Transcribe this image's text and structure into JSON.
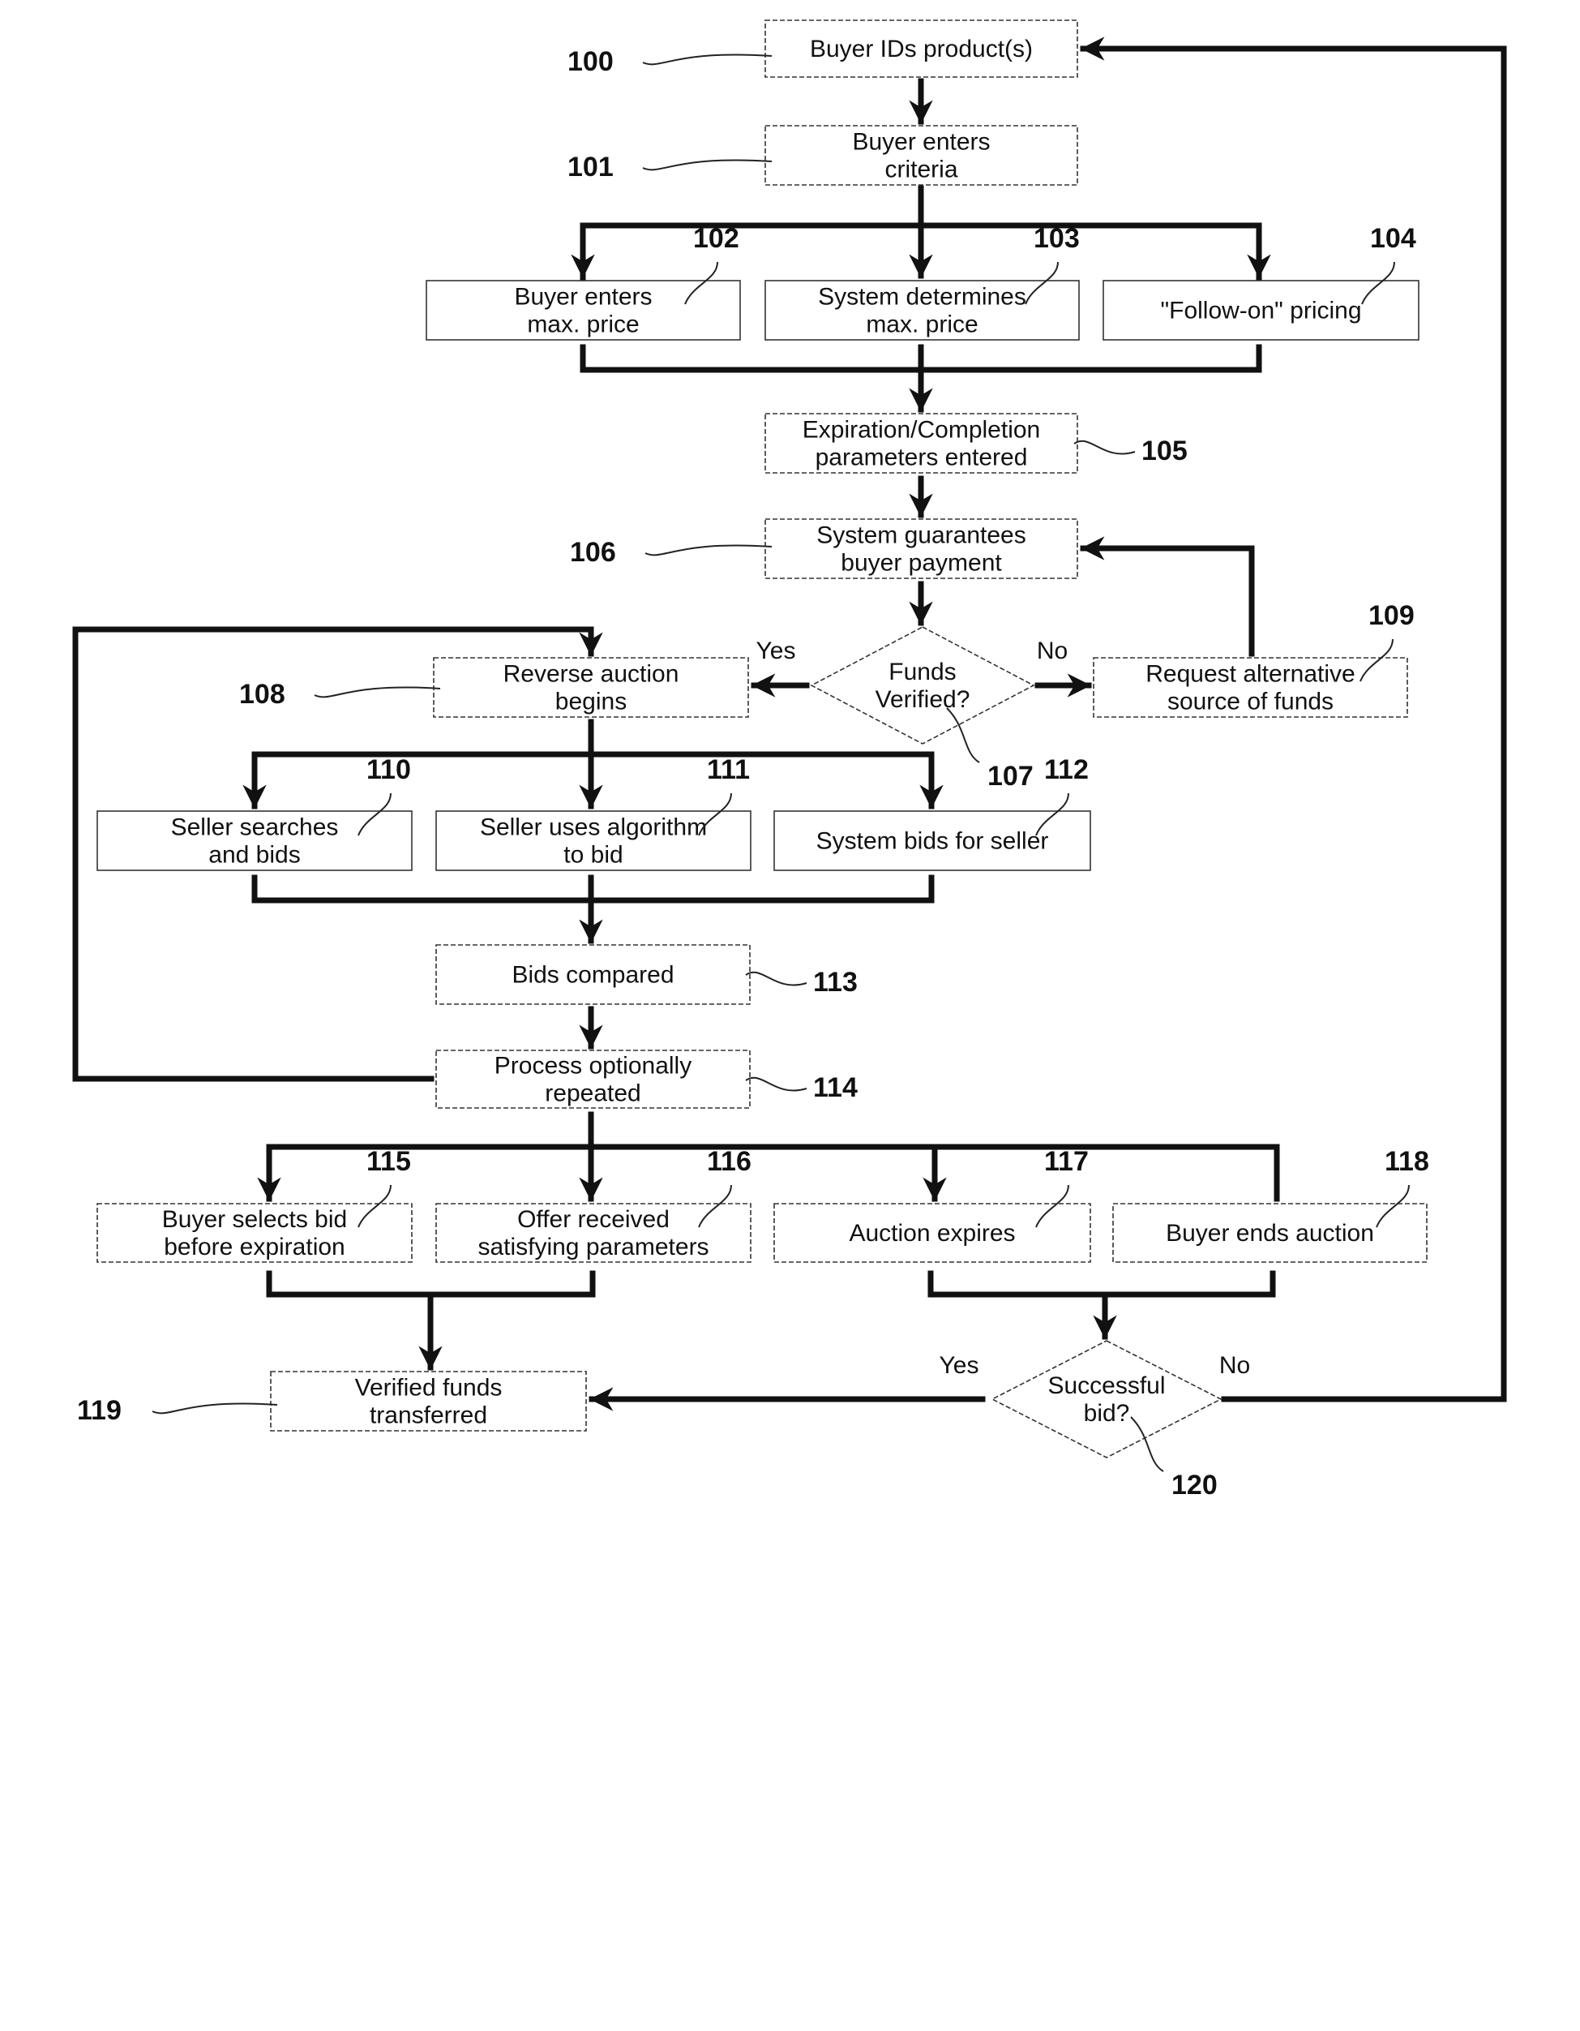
{
  "diagram": {
    "type": "flowchart",
    "nodes": [
      {
        "id": "100",
        "ref": "100",
        "shape": "process",
        "lines": [
          "Buyer IDs product(s)"
        ]
      },
      {
        "id": "101",
        "ref": "101",
        "shape": "process",
        "lines": [
          "Buyer enters",
          "criteria"
        ]
      },
      {
        "id": "102",
        "ref": "102",
        "shape": "process",
        "lines": [
          "Buyer enters",
          "max. price"
        ]
      },
      {
        "id": "103",
        "ref": "103",
        "shape": "process",
        "lines": [
          "System determines",
          "max. price"
        ]
      },
      {
        "id": "104",
        "ref": "104",
        "shape": "process",
        "lines": [
          "\"Follow-on\" pricing"
        ]
      },
      {
        "id": "105",
        "ref": "105",
        "shape": "process",
        "lines": [
          "Expiration/Completion",
          "parameters entered"
        ]
      },
      {
        "id": "106",
        "ref": "106",
        "shape": "process",
        "lines": [
          "System guarantees",
          "buyer payment"
        ]
      },
      {
        "id": "107",
        "ref": "107",
        "shape": "decision",
        "lines": [
          "Funds",
          "Verified?"
        ]
      },
      {
        "id": "108",
        "ref": "108",
        "shape": "process",
        "lines": [
          "Reverse auction",
          "begins"
        ]
      },
      {
        "id": "109",
        "ref": "109",
        "shape": "process",
        "lines": [
          "Request alternative",
          "source of funds"
        ]
      },
      {
        "id": "110",
        "ref": "110",
        "shape": "process",
        "lines": [
          "Seller searches",
          "and bids"
        ]
      },
      {
        "id": "111",
        "ref": "111",
        "shape": "process",
        "lines": [
          "Seller uses algorithm",
          "to bid"
        ]
      },
      {
        "id": "112",
        "ref": "112",
        "shape": "process",
        "lines": [
          "System bids for seller"
        ]
      },
      {
        "id": "113",
        "ref": "113",
        "shape": "process",
        "lines": [
          "Bids compared"
        ]
      },
      {
        "id": "114",
        "ref": "114",
        "shape": "process",
        "lines": [
          "Process optionally",
          "repeated"
        ]
      },
      {
        "id": "115",
        "ref": "115",
        "shape": "process",
        "lines": [
          "Buyer selects bid",
          "before expiration"
        ]
      },
      {
        "id": "116",
        "ref": "116",
        "shape": "process",
        "lines": [
          "Offer received",
          "satisfying parameters"
        ]
      },
      {
        "id": "117",
        "ref": "117",
        "shape": "process",
        "lines": [
          "Auction expires"
        ]
      },
      {
        "id": "118",
        "ref": "118",
        "shape": "process",
        "lines": [
          "Buyer ends auction"
        ]
      },
      {
        "id": "119",
        "ref": "119",
        "shape": "process",
        "lines": [
          "Verified funds",
          "transferred"
        ]
      },
      {
        "id": "120",
        "ref": "120",
        "shape": "decision",
        "lines": [
          "Successful",
          "bid?"
        ]
      }
    ],
    "edge_labels": {
      "d107_yes": "Yes",
      "d107_no": "No",
      "d120_yes": "Yes",
      "d120_no": "No"
    },
    "edges": [
      {
        "from": "100",
        "to": "101"
      },
      {
        "from": "101",
        "to": "102"
      },
      {
        "from": "101",
        "to": "103"
      },
      {
        "from": "101",
        "to": "104"
      },
      {
        "from": "102",
        "to": "105"
      },
      {
        "from": "103",
        "to": "105"
      },
      {
        "from": "104",
        "to": "105"
      },
      {
        "from": "105",
        "to": "106"
      },
      {
        "from": "106",
        "to": "107"
      },
      {
        "from": "107",
        "to": "108",
        "label": "Yes"
      },
      {
        "from": "107",
        "to": "109",
        "label": "No"
      },
      {
        "from": "109",
        "to": "106"
      },
      {
        "from": "108",
        "to": "110"
      },
      {
        "from": "108",
        "to": "111"
      },
      {
        "from": "108",
        "to": "112"
      },
      {
        "from": "110",
        "to": "113"
      },
      {
        "from": "111",
        "to": "113"
      },
      {
        "from": "112",
        "to": "113"
      },
      {
        "from": "113",
        "to": "114"
      },
      {
        "from": "114",
        "to": "108"
      },
      {
        "from": "114",
        "to": "115"
      },
      {
        "from": "114",
        "to": "116"
      },
      {
        "from": "114",
        "to": "117"
      },
      {
        "from": "114",
        "to": "118"
      },
      {
        "from": "115",
        "to": "119"
      },
      {
        "from": "116",
        "to": "119"
      },
      {
        "from": "117",
        "to": "120"
      },
      {
        "from": "118",
        "to": "120"
      },
      {
        "from": "120",
        "to": "119",
        "label": "Yes"
      },
      {
        "from": "120",
        "to": "100",
        "label": "No"
      }
    ]
  }
}
